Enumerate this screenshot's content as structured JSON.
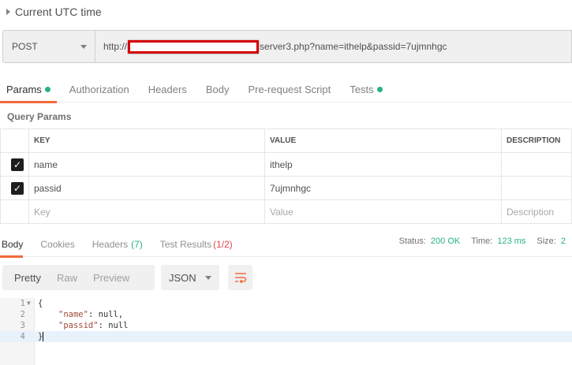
{
  "request": {
    "title": "Current UTC time",
    "method": "POST",
    "url_prefix": "http://",
    "url_suffix": "server3.php?name=ithelp&passid=7ujmnhgc"
  },
  "request_tabs": [
    {
      "label": "Params",
      "dot": true
    },
    {
      "label": "Authorization"
    },
    {
      "label": "Headers"
    },
    {
      "label": "Body"
    },
    {
      "label": "Pre-request Script"
    },
    {
      "label": "Tests",
      "dot": true
    }
  ],
  "query_params": {
    "label": "Query Params",
    "headers": {
      "key": "KEY",
      "value": "VALUE",
      "description": "DESCRIPTION"
    },
    "rows": [
      {
        "checked": true,
        "key": "name",
        "value": "ithelp",
        "description": ""
      },
      {
        "checked": true,
        "key": "passid",
        "value": "7ujmnhgc",
        "description": ""
      }
    ],
    "placeholder": {
      "key": "Key",
      "value": "Value",
      "description": "Description"
    }
  },
  "response": {
    "tabs": {
      "body": "Body",
      "cookies": "Cookies",
      "headers": "Headers",
      "headers_count": "(7)",
      "test_results": "Test Results",
      "test_results_count": "(1/2)"
    },
    "status_label": "Status:",
    "status_value": "200 OK",
    "time_label": "Time:",
    "time_value": "123 ms",
    "size_label": "Size:",
    "size_value": "2"
  },
  "view": {
    "pretty": "Pretty",
    "raw": "Raw",
    "preview": "Preview",
    "format": "JSON"
  },
  "editor": {
    "line_numbers": [
      "1",
      "2",
      "3",
      "4"
    ],
    "line1": "{",
    "line2_key": "\"name\"",
    "line2_rest": ": null,",
    "line3_key": "\"passid\"",
    "line3_rest": ": null",
    "line4": "}"
  },
  "colors": {
    "accent": "#f26b3a",
    "success": "#26b47f",
    "error": "#e0494b",
    "redaction_border": "#d40000"
  }
}
